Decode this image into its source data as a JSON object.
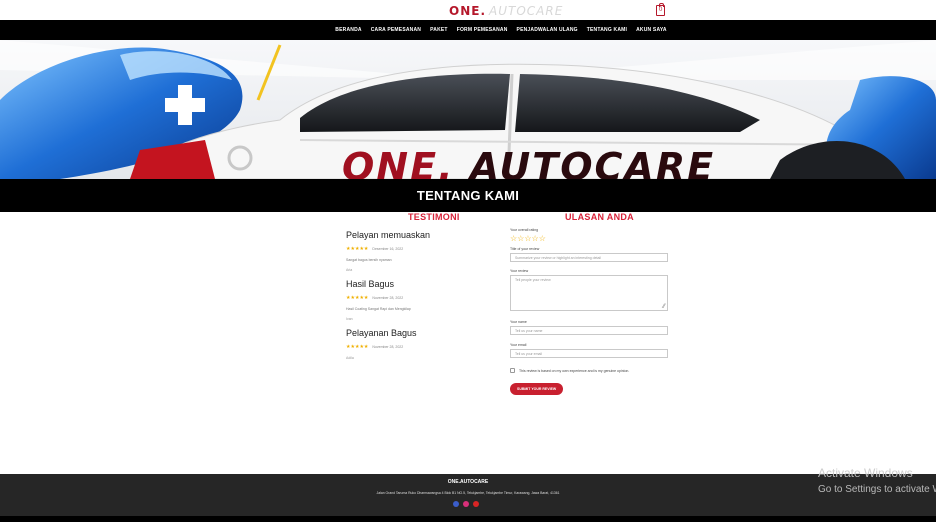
{
  "brand": {
    "one": "ONE.",
    "autocare": "AUTOCARE"
  },
  "nav": {
    "items": [
      "BERANDA",
      "CARA PEMESANAN",
      "PAKET",
      "FORM PEMESANAN",
      "PENJADWALAN ULANG",
      "TENTANG KAMI",
      "AKUN SAYA"
    ]
  },
  "cart": {
    "count": "0"
  },
  "hero": {
    "logo_one": "ONE.",
    "logo_autocare": "AUTOCARE"
  },
  "section": {
    "title": "TENTANG KAMI"
  },
  "testimonials": {
    "title": "TESTIMONI",
    "reviews": [
      {
        "title": "Pelayan memuaskan",
        "date": "Desember 16, 2022",
        "text": "Sangat bagus bersih nyaman",
        "author": "Aria"
      },
      {
        "title": "Hasil Bagus",
        "date": "November 28, 2022",
        "text": "Hasil Coating Sangat Rapi dan Mengkilap",
        "author": "Ivan"
      },
      {
        "title": "Pelayanan Bagus",
        "date": "November 28, 2022",
        "text": "",
        "author": "Adila"
      }
    ]
  },
  "review_form": {
    "title": "ULASAN ANDA",
    "overall_label": "Your overall rating",
    "title_label": "Title of your review",
    "title_placeholder": "Summarize your review or highlight an interesting detail",
    "review_label": "Your review",
    "review_placeholder": "Tell people your review",
    "name_label": "Your name",
    "name_placeholder": "Tell us your name",
    "email_label": "Your email",
    "email_placeholder": "Tell us your email",
    "consent": "This review is based on my own experience and is my genuine opinion.",
    "submit": "SUBMIT YOUR REVIEW"
  },
  "footer": {
    "title": "ONE.AUTOCARE",
    "address": "Jalan Grand Taruma Ruko Dharmawangsa 4 Blok B1 NO.5, Telukjambe, Telukjambe Timur, Karawang, Jawa Barat, 41361"
  },
  "watermark": {
    "line1": "Activate Windows",
    "line2": "Go to Settings to activate Windows."
  },
  "colors": {
    "accent": "#c8202f",
    "nav_bg": "#000000",
    "footer_bg": "#262626",
    "star": "#f0b000"
  }
}
